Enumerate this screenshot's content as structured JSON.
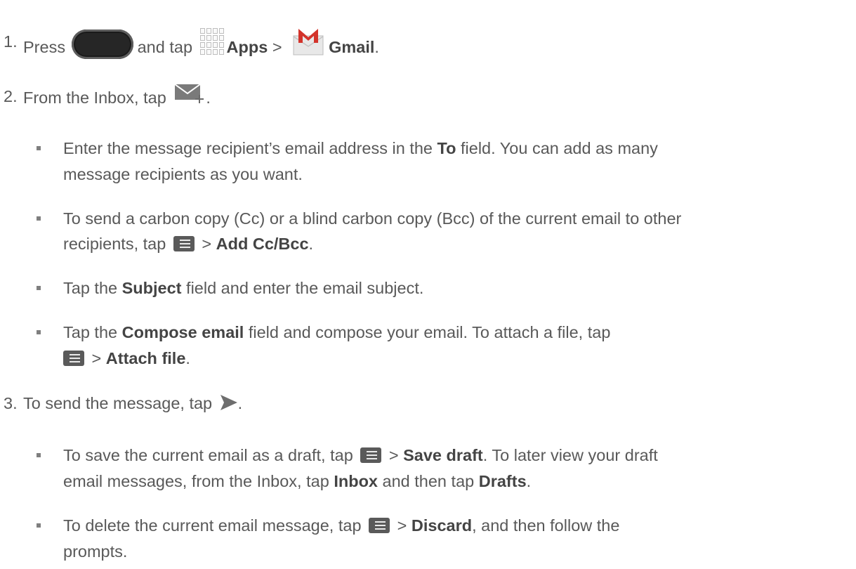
{
  "steps": [
    {
      "num": "1.",
      "p1": "Press",
      "p2": "and tap",
      "apps_label": "Apps",
      "gt": ">",
      "gmail_label": "Gmail",
      "end": "."
    },
    {
      "num": "2.",
      "p1": "From the Inbox, tap",
      "end": "."
    },
    {
      "num": "3.",
      "p1": "To send the message, tap",
      "end": "."
    }
  ],
  "bullets": {
    "b1": {
      "l1_a": "Enter the message recipient’s email address in the ",
      "l1_b": "To",
      "l1_c": " field. You can add as many",
      "l2": "message recipients as you want."
    },
    "b2": {
      "l1": "To send a carbon copy (Cc) or a blind carbon copy (Bcc) of the current email to other",
      "l2_a": "recipients, tap",
      "gt": ">",
      "l2_b": "Add Cc/Bcc",
      "end": "."
    },
    "b3": {
      "a": "Tap the ",
      "b": "Subject",
      "c": " field and enter the email subject."
    },
    "b4": {
      "l1_a": "Tap the ",
      "l1_b": "Compose email",
      "l1_c": " field and compose your email. To attach a file, tap",
      "gt": ">",
      "l2_b": "Attach file",
      "end": "."
    },
    "b5": {
      "l1_a": "To save the current email as a draft, tap",
      "gt": ">",
      "l1_b": "Save draft",
      "l1_c": ". To later view your draft",
      "l2_a": "email messages, from the Inbox, tap ",
      "l2_b": "Inbox",
      "l2_c": " and then tap ",
      "l2_d": "Drafts",
      "end": "."
    },
    "b6": {
      "l1_a": "To delete the current email message, tap",
      "gt": ">",
      "l1_b": "Discard",
      "l1_c": ", and then follow the",
      "l2": "prompts."
    }
  },
  "icons": {
    "home_button": "home-button-icon",
    "apps": "apps-grid-icon",
    "gmail": "gmail-icon",
    "compose": "compose-mail-icon",
    "menu": "menu-icon",
    "send": "send-icon"
  },
  "colors": {
    "text": "#595959",
    "gmail_red": "#d3332b"
  }
}
